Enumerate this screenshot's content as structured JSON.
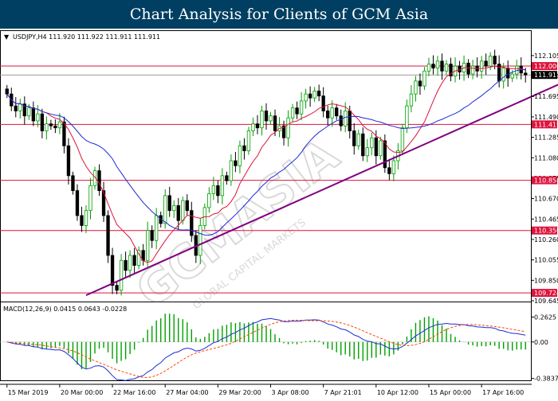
{
  "title": "Chart Analysis for Clients of GCM Asia",
  "watermark": "GCMASIA",
  "watermark_sub": "GLOBAL CAPITAL MARKETS",
  "chart_data": [
    {
      "type": "candlestick",
      "header": "USDJPY,H4  111.920 111.922 111.911 111.911",
      "symbol": "USDJPY",
      "timeframe": "H4",
      "ohlc_header": [
        111.92,
        111.922,
        111.911,
        111.911
      ],
      "ylim": [
        109.645,
        112.2
      ],
      "y_ticks": [
        112.105,
        111.9,
        111.695,
        111.49,
        111.285,
        111.08,
        110.875,
        110.67,
        110.465,
        110.26,
        110.055,
        109.85,
        109.645
      ],
      "x_ticks": [
        {
          "x": 0,
          "label": "15 Mar 2019"
        },
        {
          "x": 12,
          "label": "20 Mar 00:00"
        },
        {
          "x": 24,
          "label": "22 Mar 16:00"
        },
        {
          "x": 36,
          "label": "27 Mar 04:00"
        },
        {
          "x": 48,
          "label": "29 Mar 20:00"
        },
        {
          "x": 60,
          "label": "3 Apr 08:00"
        },
        {
          "x": 72,
          "label": "7 Apr 21:01"
        },
        {
          "x": 84,
          "label": "10 Apr 12:00"
        },
        {
          "x": 96,
          "label": "15 Apr 00:00"
        },
        {
          "x": 108,
          "label": "17 Apr 16:00"
        }
      ],
      "levels": [
        {
          "value": 112.0,
          "label": "112.000",
          "color": "#dc143c"
        },
        {
          "value": 111.415,
          "label": "111.415",
          "color": "#dc143c"
        },
        {
          "value": 110.854,
          "label": "110.854",
          "color": "#dc143c"
        },
        {
          "value": 110.35,
          "label": "110.350",
          "color": "#dc143c"
        },
        {
          "value": 109.724,
          "label": "109.724",
          "color": "#dc143c"
        }
      ],
      "current_price": {
        "value": 111.911,
        "label": "111.911",
        "color": "#000000"
      },
      "trendline": {
        "start": {
          "x": 18,
          "y": 109.7
        },
        "end": {
          "x": 140,
          "y": 112.1
        },
        "color": "#800080"
      },
      "ma_fast_color": "#dc143c",
      "ma_slow_color": "#1e2bd6",
      "candle_up_color": "#00a000",
      "candle_down_color": "#000000",
      "closes": [
        111.72,
        111.6,
        111.55,
        111.62,
        111.5,
        111.58,
        111.45,
        111.52,
        111.35,
        111.42,
        111.4,
        111.38,
        111.44,
        111.2,
        110.9,
        110.75,
        110.5,
        110.4,
        110.55,
        110.8,
        110.95,
        110.75,
        110.5,
        110.1,
        109.8,
        109.75,
        110.05,
        109.95,
        110.1,
        110.0,
        110.15,
        110.05,
        110.35,
        110.25,
        110.5,
        110.42,
        110.7,
        110.55,
        110.6,
        110.45,
        110.65,
        110.55,
        110.3,
        110.1,
        110.4,
        110.58,
        110.72,
        110.8,
        110.7,
        110.9,
        110.85,
        111.05,
        111.0,
        111.2,
        111.15,
        111.35,
        111.42,
        111.38,
        111.55,
        111.45,
        111.5,
        111.35,
        111.4,
        111.28,
        111.48,
        111.58,
        111.52,
        111.65,
        111.72,
        111.68,
        111.75,
        111.7,
        111.55,
        111.48,
        111.58,
        111.5,
        111.4,
        111.55,
        111.35,
        111.2,
        111.32,
        111.1,
        111.18,
        111.28,
        111.1,
        111.25,
        110.98,
        110.92,
        111.05,
        111.15,
        111.38,
        111.6,
        111.72,
        111.85,
        111.8,
        111.95,
        112.02,
        111.98,
        112.05,
        111.95,
        112.02,
        111.9,
        112.0,
        111.94,
        112.03,
        111.92,
        112.0,
        111.95,
        112.05,
        112.0,
        112.1,
        112.02,
        111.85,
        111.98,
        111.88,
        111.92,
        112.0,
        111.93,
        111.911
      ]
    },
    {
      "type": "macd",
      "header": "MACD(12,26,9) 0.0415 0.0643 -0.0228",
      "params": "MACD(12,26,9)",
      "values_header": [
        0.0415,
        0.0643,
        -0.0228
      ],
      "ylim": [
        -0.42,
        0.3
      ],
      "y_ticks": [
        0.2625,
        0.0,
        -0.3837
      ],
      "macd_color": "#1e2bd6",
      "signal_color": "#ff4500",
      "histogram_color": "#00a000"
    }
  ]
}
